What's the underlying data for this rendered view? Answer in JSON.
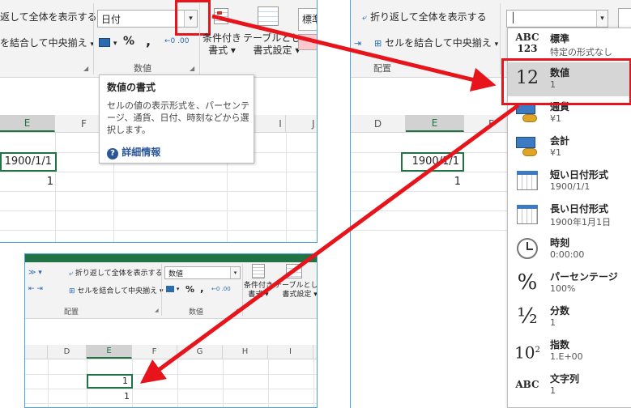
{
  "panel1": {
    "wrap_text": "返して全体を表示する",
    "merge_center": "を結合して中央揃え",
    "number_format": "日付",
    "cond_format": "条件付き",
    "cond_format2": "書式",
    "table_format": "テーブルとして",
    "table_format2": "書式設定",
    "style_combo": "標準",
    "group_number": "数値",
    "percent": "%",
    "comma": ",",
    "cols": [
      "E",
      "F",
      "I",
      "J"
    ],
    "cell_e1": "1900/1/1",
    "cell_e2": "1",
    "tooltip": {
      "title": "数値の書式",
      "body": "セルの値の表示形式を、パーセンテージ、通貨、日付、時刻などから選択します。",
      "link": "詳細情報"
    }
  },
  "panel2": {
    "wrap_text": "折り返して全体を表示する",
    "merge_center": "セルを結合して中央揃え",
    "group_align": "配置",
    "cols": [
      "D",
      "E",
      "F"
    ],
    "cell_e1": "1900/1/1",
    "cell_e2": "1",
    "menu": [
      {
        "icon": "ABC 123",
        "title": "標準",
        "sub": "特定の形式なし"
      },
      {
        "icon": "12",
        "title": "数値",
        "sub": "1"
      },
      {
        "icon": "coins",
        "title": "通貨",
        "sub": "¥1"
      },
      {
        "icon": "coins",
        "title": "会計",
        "sub": " ¥1"
      },
      {
        "icon": "calendar",
        "title": "短い日付形式",
        "sub": "1900/1/1"
      },
      {
        "icon": "calendar",
        "title": "長い日付形式",
        "sub": "1900年1月1日"
      },
      {
        "icon": "clock",
        "title": "時刻",
        "sub": "0:00:00"
      },
      {
        "icon": "%",
        "title": "パーセンテージ",
        "sub": "100%"
      },
      {
        "icon": "½",
        "title": "分数",
        "sub": "1"
      },
      {
        "icon": "10²",
        "title": "指数",
        "sub": "1.E+00"
      },
      {
        "icon": "ABC",
        "title": "文字列",
        "sub": "1"
      }
    ]
  },
  "panel3": {
    "wrap_text": "折り返して全体を表示する",
    "merge_center": "セルを結合して中央揃え",
    "number_format": "数値",
    "cond_format": "条件付き",
    "cond_format2": "書式",
    "table_format": "テーブルとして",
    "table_format2": "書式設定",
    "group_align": "配置",
    "group_number": "数値",
    "percent": "%",
    "comma": ",",
    "cols": [
      "D",
      "E",
      "F",
      "G",
      "H",
      "I"
    ],
    "cell_e1": "1",
    "cell_e2": "1"
  },
  "colors": {
    "arrow": "#e8141b",
    "excel_green": "#217346",
    "highlight_box": "#e8141b"
  }
}
